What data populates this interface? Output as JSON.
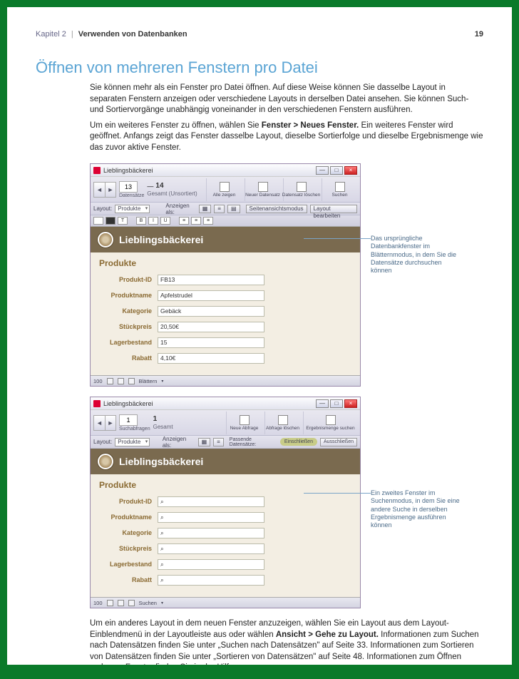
{
  "header": {
    "chapter": "Kapitel 2",
    "title": "Verwenden von Datenbanken",
    "page_number": "19"
  },
  "section_heading": "Öffnen von mehreren Fenstern pro Datei",
  "paragraphs": {
    "p1": "Sie können mehr als ein Fenster pro Datei öffnen. Auf diese Weise können Sie dasselbe Layout in separaten Fenstern anzeigen oder verschiedene Layouts in derselben Datei ansehen. Sie können Such- und Sortiervorgänge unabhängig voneinander in den verschiedenen Fenstern ausführen.",
    "p2a": "Um ein weiteres Fenster zu öffnen, wählen Sie ",
    "p2b": "Fenster > Neues Fenster.",
    "p2c": " Ein weiteres Fenster wird geöffnet. Anfangs zeigt das Fenster dasselbe Layout, dieselbe Sortierfolge und dieselbe Ergebnismenge wie das zuvor aktive Fenster.",
    "p3a": "Um ein anderes Layout in dem neuen Fenster anzuzeigen, wählen Sie ein Layout aus dem Layout-Einblendmenü in der Layoutleiste aus oder wählen ",
    "p3b": "Ansicht > Gehe zu Layout.",
    "p3c": " Informationen zum Suchen nach Datensätzen finden Sie unter „Suchen nach Datensätzen\" auf Seite 33. Informationen zum Sortieren von Datensätzen finden Sie unter „Sortieren von Datensätzen\" auf Seite 48. Informationen zum Öffnen mehrerer Fenster finden Sie in der Hilfe."
  },
  "window1": {
    "app_title": "Lieblingsbäckerei",
    "record_num": "13",
    "slider_icon": "—",
    "count": "14",
    "count_label": "Gesamt (Unsortiert)",
    "record_label": "Datensätze",
    "btn_show_all": "Alle zeigen",
    "btn_new": "Neuer Datensatz",
    "btn_delete": "Datensatz löschen",
    "btn_find": "Suchen",
    "tb2_layout": "Layout:",
    "tb2_layout_val": "Produkte",
    "tb2_view": "Anzeigen als:",
    "tb2_preview": "Seitenansichtsmodus",
    "tb2_edit": "Layout bearbeiten",
    "brand": "Lieblingsbäckerei",
    "form_title": "Produkte",
    "fields": [
      {
        "label": "Produkt-ID",
        "value": "FB13"
      },
      {
        "label": "Produktname",
        "value": "Apfelstrudel"
      },
      {
        "label": "Kategorie",
        "value": "Gebäck"
      },
      {
        "label": "Stückpreis",
        "value": "20,50€"
      },
      {
        "label": "Lagerbestand",
        "value": "15"
      },
      {
        "label": "Rabatt",
        "value": "4,10€"
      }
    ],
    "status_zoom": "100",
    "status_mode": "Blättern"
  },
  "window2": {
    "app_title": "Lieblingsbäckerei",
    "record_num": "1",
    "count": "1",
    "count_label": "Gesamt",
    "record_label": "Suchabfragen",
    "btn_new_query": "Neue Abfrage",
    "btn_delete_query": "Abfrage löschen",
    "btn_search": "Ergebnismenge suchen",
    "tb2_layout": "Layout:",
    "tb2_layout_val": "Produkte",
    "tb2_view": "Anzeigen als:",
    "tb2_matching": "Passende Datensätze:",
    "tb2_include": "Einschließen",
    "tb2_exclude": "Ausschließen",
    "brand": "Lieblingsbäckerei",
    "form_title": "Produkte",
    "fields": [
      {
        "label": "Produkt-ID",
        "value": ""
      },
      {
        "label": "Produktname",
        "value": ""
      },
      {
        "label": "Kategorie",
        "value": ""
      },
      {
        "label": "Stückpreis",
        "value": ""
      },
      {
        "label": "Lagerbestand",
        "value": ""
      },
      {
        "label": "Rabatt",
        "value": ""
      }
    ],
    "status_zoom": "100",
    "status_mode": "Suchen"
  },
  "callouts": {
    "c1": "Das ursprüngliche Datenbankfenster im Blätternmodus, in dem Sie die Datensätze durchsuchen können",
    "c2": "Ein zweites Fenster im Suchenmodus, in dem Sie eine andere Suche in derselben Ergebnismenge ausführen können"
  },
  "find_glyph": "⌕"
}
